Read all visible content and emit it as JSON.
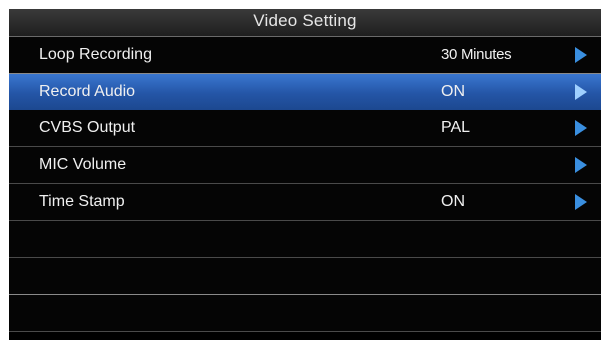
{
  "title": "Video Setting",
  "menu": {
    "items": [
      {
        "label": "Loop Recording",
        "value": "30 Minutes",
        "selected": false
      },
      {
        "label": "Record Audio",
        "value": "ON",
        "selected": true
      },
      {
        "label": "CVBS Output",
        "value": "PAL",
        "selected": false
      },
      {
        "label": "MIC Volume",
        "value": "",
        "selected": false
      },
      {
        "label": "Time Stamp",
        "value": "ON",
        "selected": false
      }
    ]
  },
  "icons": {
    "arrow": "chevron-right-icon"
  },
  "colors": {
    "background": "#000000",
    "selected_row": "#2a5fb2",
    "arrow": "#3a8fe0",
    "arrow_on_selected": "#9fd0ff",
    "text": "#f0f0f0"
  }
}
